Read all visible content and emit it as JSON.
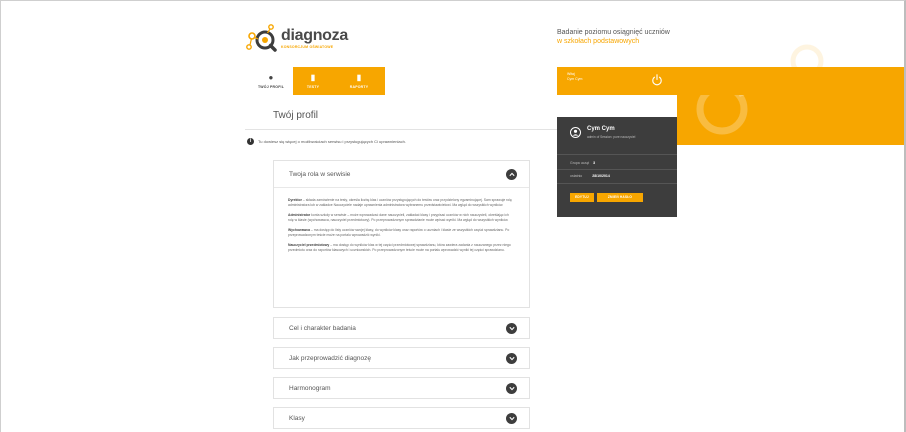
{
  "header": {
    "logo_text": "diagnoza",
    "logo_sub": "KONSORCJUM OŚWIATOWE",
    "tagline_line1": "Badanie poziomu osiągnięć uczniów",
    "tagline_line2": "w szkołach podstawowych"
  },
  "tabs": [
    {
      "label": "TWÓJ PROFIL",
      "icon": "user-icon",
      "active": true
    },
    {
      "label": "TESTY",
      "icon": "document-icon",
      "active": false
    },
    {
      "label": "RAPORTY",
      "icon": "report-icon",
      "active": false
    }
  ],
  "user_top": {
    "line1": "Witaj",
    "line2": "Cym Cym"
  },
  "page": {
    "title": "Twój profil",
    "info": "Tu dowiesz się więcej o możliwościach serwisu i przysługujących Ci uprawnieniach."
  },
  "panel": {
    "title": "Twoja rola w serwisie",
    "paragraphs": [
      {
        "term": "Dyrektor",
        "text": " – składa zamówienie na testy, określa liczbę klas i uczniów przystępujących do testów oraz przydzielony egzaminującej. Sam sprawuje rolę administratora lub w zakładce Nauczyciele nadaje uprawnienia administratora wybranemu przedstawicielowi. Ma wgląd do wszystkich wyników."
      },
      {
        "term": "Administrator",
        "text": " konta szkoły w serwisie – może wprowadzać dane nauczycieli, zakładać klasy i przypisać uczniów w nich nauczycieli, określając ich rolę w klasie (wychowawca, nauczyciel przedmiotowy). Po przeprowadzonym sprawdzianie może wpisać wyniki. Ma wgląd do wszystkich wyników."
      },
      {
        "term": "Wychowawca",
        "text": " – ma dostęp do listy uczniów swojej klasy, do wyników klasy oraz raportów o uczniach i klasie ze wszystkich części sprawdzianu. Po przeprowadzonym teście może na portalu wprowadzić wyniki."
      },
      {
        "term": "Nauczyciel przedmiotowy",
        "text": " – ma dostęp do wyników klas w tej części przedmiotowej sprawdzianu, która zawiera zadania z nauczanego przez niego przedmiotu oraz do raportów klasowych i uczniowskich. Po przeprowadzonym teście może na portalu wprowadzić wyniki tej części sprawdzianu."
      }
    ]
  },
  "accordions": [
    {
      "title": "Cel i charakter badania"
    },
    {
      "title": "Jak przeprowadzić diagnozę"
    },
    {
      "title": "Harmonogram"
    },
    {
      "title": "Klasy"
    }
  ],
  "card": {
    "name": "Cym Cym",
    "role": "admin of Session: pure nauczyciel",
    "login_label": "Grupa ucząt",
    "login_value": "3",
    "date_label": "ostatnio",
    "date_value": "28/10/2014",
    "btn_edit": "EDYTUJ",
    "btn_password": "ZMIEŃ HASŁO"
  },
  "colors": {
    "accent": "#f7a600",
    "dark": "#3d3d3d"
  }
}
